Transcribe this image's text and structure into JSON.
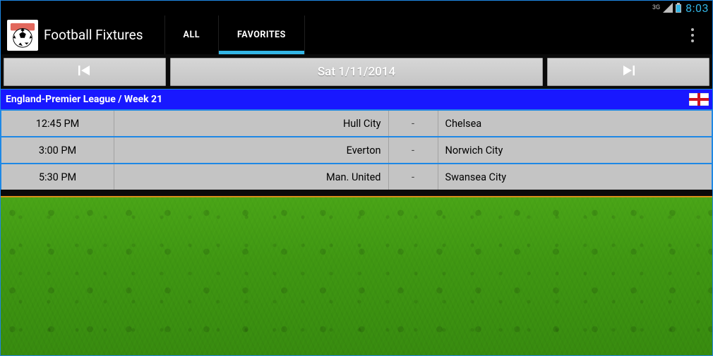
{
  "status": {
    "network": "3G",
    "clock": "8:03"
  },
  "app": {
    "title": "Football Fixtures"
  },
  "tabs": [
    {
      "label": "ALL",
      "active": false
    },
    {
      "label": "FAVORITES",
      "active": true
    }
  ],
  "dateNav": {
    "date": "Sat 1/11/2014"
  },
  "league": {
    "title": "England-Premier League / Week 21",
    "country": "England"
  },
  "fixtures": [
    {
      "time": "12:45 PM",
      "home": "Hull City",
      "score": "-",
      "away": "Chelsea"
    },
    {
      "time": "3:00 PM",
      "home": "Everton",
      "score": "-",
      "away": "Norwich City"
    },
    {
      "time": "5:30 PM",
      "home": "Man. United",
      "score": "-",
      "away": "Swansea City"
    }
  ]
}
